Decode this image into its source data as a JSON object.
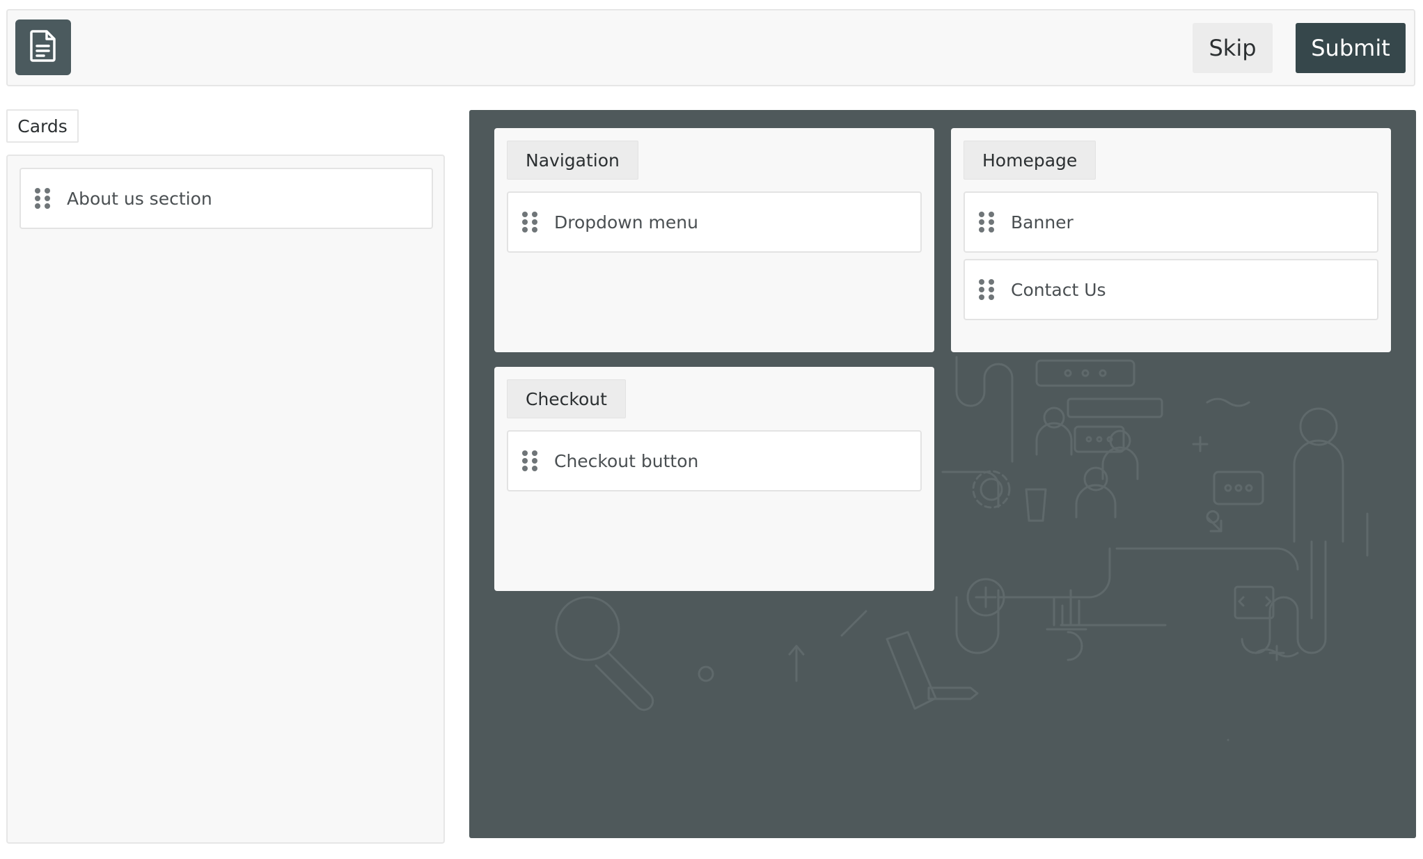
{
  "header": {
    "logo_icon": "document-icon",
    "skip_label": "Skip",
    "submit_label": "Submit"
  },
  "pool": {
    "tab_label": "Cards",
    "cards": [
      {
        "label": "About us section"
      }
    ]
  },
  "board": {
    "categories": [
      {
        "title": "Navigation",
        "cards": [
          {
            "label": "Dropdown menu"
          }
        ]
      },
      {
        "title": "Homepage",
        "cards": [
          {
            "label": "Banner"
          },
          {
            "label": "Contact Us"
          }
        ]
      },
      {
        "title": "Checkout",
        "cards": [
          {
            "label": "Checkout button"
          }
        ]
      }
    ]
  },
  "colors": {
    "brand_dark": "#36474b",
    "logo_bg": "#4b5a5e",
    "board_bg": "#4f595b",
    "panel_bg": "#f8f8f8"
  }
}
